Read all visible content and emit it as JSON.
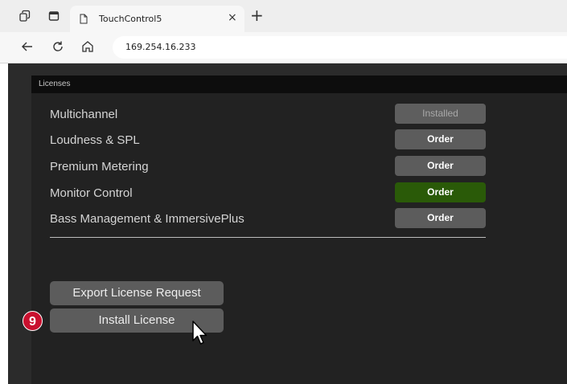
{
  "browser": {
    "tab_title": "TouchControl5",
    "close_glyph": "×",
    "newtab_glyph": "+",
    "address": "169.254.16.233",
    "icons": [
      "workspaces-icon",
      "tab-actions-icon",
      "document-icon",
      "back-icon",
      "refresh-icon",
      "home-icon"
    ]
  },
  "panel": {
    "title": "Licenses",
    "licenses": [
      {
        "name": "Multichannel",
        "button": "Installed",
        "state": "installed"
      },
      {
        "name": "Loudness & SPL",
        "button": "Order",
        "state": "available"
      },
      {
        "name": "Premium Metering",
        "button": "Order",
        "state": "available"
      },
      {
        "name": "Monitor Control",
        "button": "Order",
        "state": "highlighted"
      },
      {
        "name": "Bass Management & ImmersivePlus",
        "button": "Order",
        "state": "available"
      }
    ],
    "export_button": "Export License Request",
    "install_button": "Install License"
  },
  "annotation": {
    "step": "9"
  },
  "colors": {
    "accent_green": "#2a5a08",
    "badge_red": "#c8102e",
    "panel_bg": "#222222"
  }
}
